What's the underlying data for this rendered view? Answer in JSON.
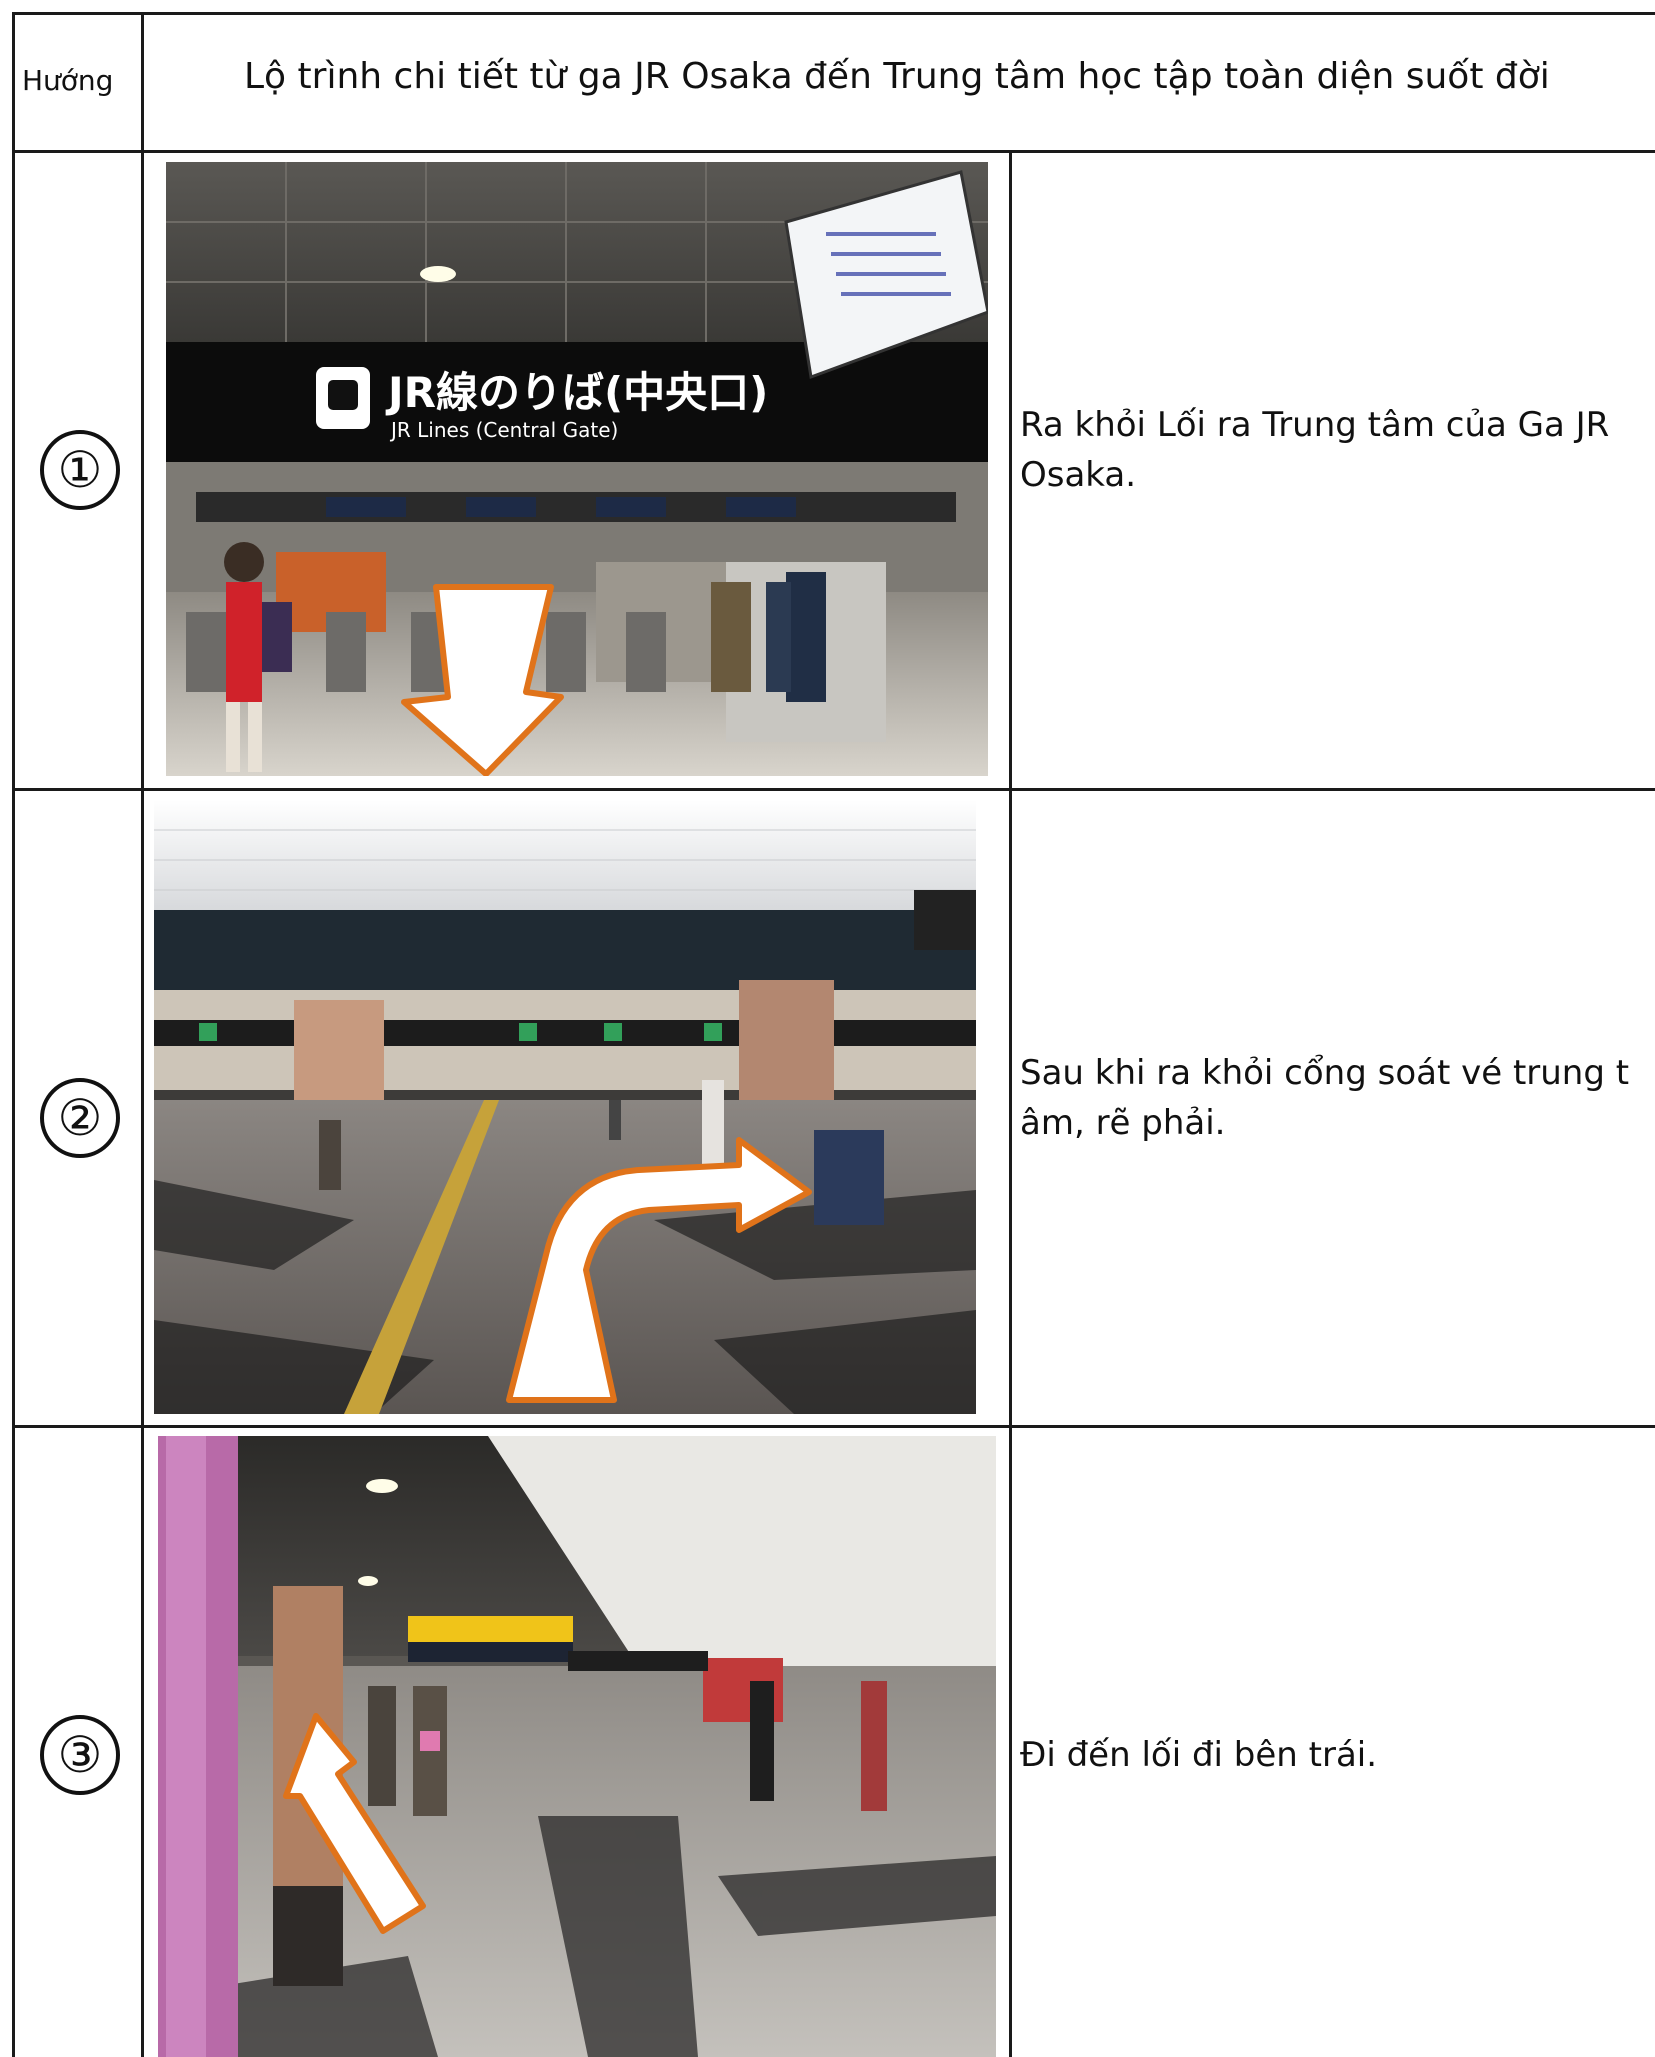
{
  "header": {
    "direction_label": "Hướng",
    "title": "Lộ trình chi tiết từ ga JR Osaka đến Trung tâm học tập toàn diện suốt đời"
  },
  "steps": [
    {
      "number": "①",
      "photo_sign_main": "JR線のりば(中央口)",
      "photo_sign_sub": "JR Lines (Central Gate)",
      "text": "Ra khỏi Lối ra Trung tâm của Ga JR\nOsaka."
    },
    {
      "number": "②",
      "text": "Sau khi ra khỏi cổng soát vé trung t\nâm, rẽ phải."
    },
    {
      "number": "③",
      "text": "Đi đến lối đi bên trái."
    }
  ],
  "colors": {
    "arrow_outline": "#e0731a",
    "arrow_fill": "#ffffff",
    "grid": "#1a1a1a"
  }
}
